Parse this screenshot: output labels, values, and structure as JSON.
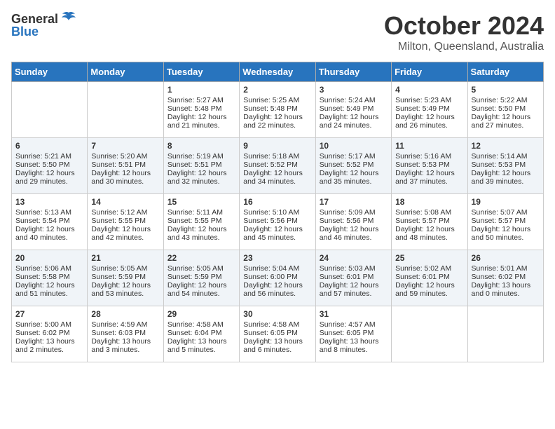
{
  "header": {
    "logo_general": "General",
    "logo_blue": "Blue",
    "title": "October 2024",
    "subtitle": "Milton, Queensland, Australia"
  },
  "days_of_week": [
    "Sunday",
    "Monday",
    "Tuesday",
    "Wednesday",
    "Thursday",
    "Friday",
    "Saturday"
  ],
  "weeks": [
    [
      {
        "day": "",
        "sunrise": "",
        "sunset": "",
        "daylight": ""
      },
      {
        "day": "",
        "sunrise": "",
        "sunset": "",
        "daylight": ""
      },
      {
        "day": "1",
        "sunrise": "Sunrise: 5:27 AM",
        "sunset": "Sunset: 5:48 PM",
        "daylight": "Daylight: 12 hours and 21 minutes."
      },
      {
        "day": "2",
        "sunrise": "Sunrise: 5:25 AM",
        "sunset": "Sunset: 5:48 PM",
        "daylight": "Daylight: 12 hours and 22 minutes."
      },
      {
        "day": "3",
        "sunrise": "Sunrise: 5:24 AM",
        "sunset": "Sunset: 5:49 PM",
        "daylight": "Daylight: 12 hours and 24 minutes."
      },
      {
        "day": "4",
        "sunrise": "Sunrise: 5:23 AM",
        "sunset": "Sunset: 5:49 PM",
        "daylight": "Daylight: 12 hours and 26 minutes."
      },
      {
        "day": "5",
        "sunrise": "Sunrise: 5:22 AM",
        "sunset": "Sunset: 5:50 PM",
        "daylight": "Daylight: 12 hours and 27 minutes."
      }
    ],
    [
      {
        "day": "6",
        "sunrise": "Sunrise: 5:21 AM",
        "sunset": "Sunset: 5:50 PM",
        "daylight": "Daylight: 12 hours and 29 minutes."
      },
      {
        "day": "7",
        "sunrise": "Sunrise: 5:20 AM",
        "sunset": "Sunset: 5:51 PM",
        "daylight": "Daylight: 12 hours and 30 minutes."
      },
      {
        "day": "8",
        "sunrise": "Sunrise: 5:19 AM",
        "sunset": "Sunset: 5:51 PM",
        "daylight": "Daylight: 12 hours and 32 minutes."
      },
      {
        "day": "9",
        "sunrise": "Sunrise: 5:18 AM",
        "sunset": "Sunset: 5:52 PM",
        "daylight": "Daylight: 12 hours and 34 minutes."
      },
      {
        "day": "10",
        "sunrise": "Sunrise: 5:17 AM",
        "sunset": "Sunset: 5:52 PM",
        "daylight": "Daylight: 12 hours and 35 minutes."
      },
      {
        "day": "11",
        "sunrise": "Sunrise: 5:16 AM",
        "sunset": "Sunset: 5:53 PM",
        "daylight": "Daylight: 12 hours and 37 minutes."
      },
      {
        "day": "12",
        "sunrise": "Sunrise: 5:14 AM",
        "sunset": "Sunset: 5:53 PM",
        "daylight": "Daylight: 12 hours and 39 minutes."
      }
    ],
    [
      {
        "day": "13",
        "sunrise": "Sunrise: 5:13 AM",
        "sunset": "Sunset: 5:54 PM",
        "daylight": "Daylight: 12 hours and 40 minutes."
      },
      {
        "day": "14",
        "sunrise": "Sunrise: 5:12 AM",
        "sunset": "Sunset: 5:55 PM",
        "daylight": "Daylight: 12 hours and 42 minutes."
      },
      {
        "day": "15",
        "sunrise": "Sunrise: 5:11 AM",
        "sunset": "Sunset: 5:55 PM",
        "daylight": "Daylight: 12 hours and 43 minutes."
      },
      {
        "day": "16",
        "sunrise": "Sunrise: 5:10 AM",
        "sunset": "Sunset: 5:56 PM",
        "daylight": "Daylight: 12 hours and 45 minutes."
      },
      {
        "day": "17",
        "sunrise": "Sunrise: 5:09 AM",
        "sunset": "Sunset: 5:56 PM",
        "daylight": "Daylight: 12 hours and 46 minutes."
      },
      {
        "day": "18",
        "sunrise": "Sunrise: 5:08 AM",
        "sunset": "Sunset: 5:57 PM",
        "daylight": "Daylight: 12 hours and 48 minutes."
      },
      {
        "day": "19",
        "sunrise": "Sunrise: 5:07 AM",
        "sunset": "Sunset: 5:57 PM",
        "daylight": "Daylight: 12 hours and 50 minutes."
      }
    ],
    [
      {
        "day": "20",
        "sunrise": "Sunrise: 5:06 AM",
        "sunset": "Sunset: 5:58 PM",
        "daylight": "Daylight: 12 hours and 51 minutes."
      },
      {
        "day": "21",
        "sunrise": "Sunrise: 5:05 AM",
        "sunset": "Sunset: 5:59 PM",
        "daylight": "Daylight: 12 hours and 53 minutes."
      },
      {
        "day": "22",
        "sunrise": "Sunrise: 5:05 AM",
        "sunset": "Sunset: 5:59 PM",
        "daylight": "Daylight: 12 hours and 54 minutes."
      },
      {
        "day": "23",
        "sunrise": "Sunrise: 5:04 AM",
        "sunset": "Sunset: 6:00 PM",
        "daylight": "Daylight: 12 hours and 56 minutes."
      },
      {
        "day": "24",
        "sunrise": "Sunrise: 5:03 AM",
        "sunset": "Sunset: 6:01 PM",
        "daylight": "Daylight: 12 hours and 57 minutes."
      },
      {
        "day": "25",
        "sunrise": "Sunrise: 5:02 AM",
        "sunset": "Sunset: 6:01 PM",
        "daylight": "Daylight: 12 hours and 59 minutes."
      },
      {
        "day": "26",
        "sunrise": "Sunrise: 5:01 AM",
        "sunset": "Sunset: 6:02 PM",
        "daylight": "Daylight: 13 hours and 0 minutes."
      }
    ],
    [
      {
        "day": "27",
        "sunrise": "Sunrise: 5:00 AM",
        "sunset": "Sunset: 6:02 PM",
        "daylight": "Daylight: 13 hours and 2 minutes."
      },
      {
        "day": "28",
        "sunrise": "Sunrise: 4:59 AM",
        "sunset": "Sunset: 6:03 PM",
        "daylight": "Daylight: 13 hours and 3 minutes."
      },
      {
        "day": "29",
        "sunrise": "Sunrise: 4:58 AM",
        "sunset": "Sunset: 6:04 PM",
        "daylight": "Daylight: 13 hours and 5 minutes."
      },
      {
        "day": "30",
        "sunrise": "Sunrise: 4:58 AM",
        "sunset": "Sunset: 6:05 PM",
        "daylight": "Daylight: 13 hours and 6 minutes."
      },
      {
        "day": "31",
        "sunrise": "Sunrise: 4:57 AM",
        "sunset": "Sunset: 6:05 PM",
        "daylight": "Daylight: 13 hours and 8 minutes."
      },
      {
        "day": "",
        "sunrise": "",
        "sunset": "",
        "daylight": ""
      },
      {
        "day": "",
        "sunrise": "",
        "sunset": "",
        "daylight": ""
      }
    ]
  ]
}
